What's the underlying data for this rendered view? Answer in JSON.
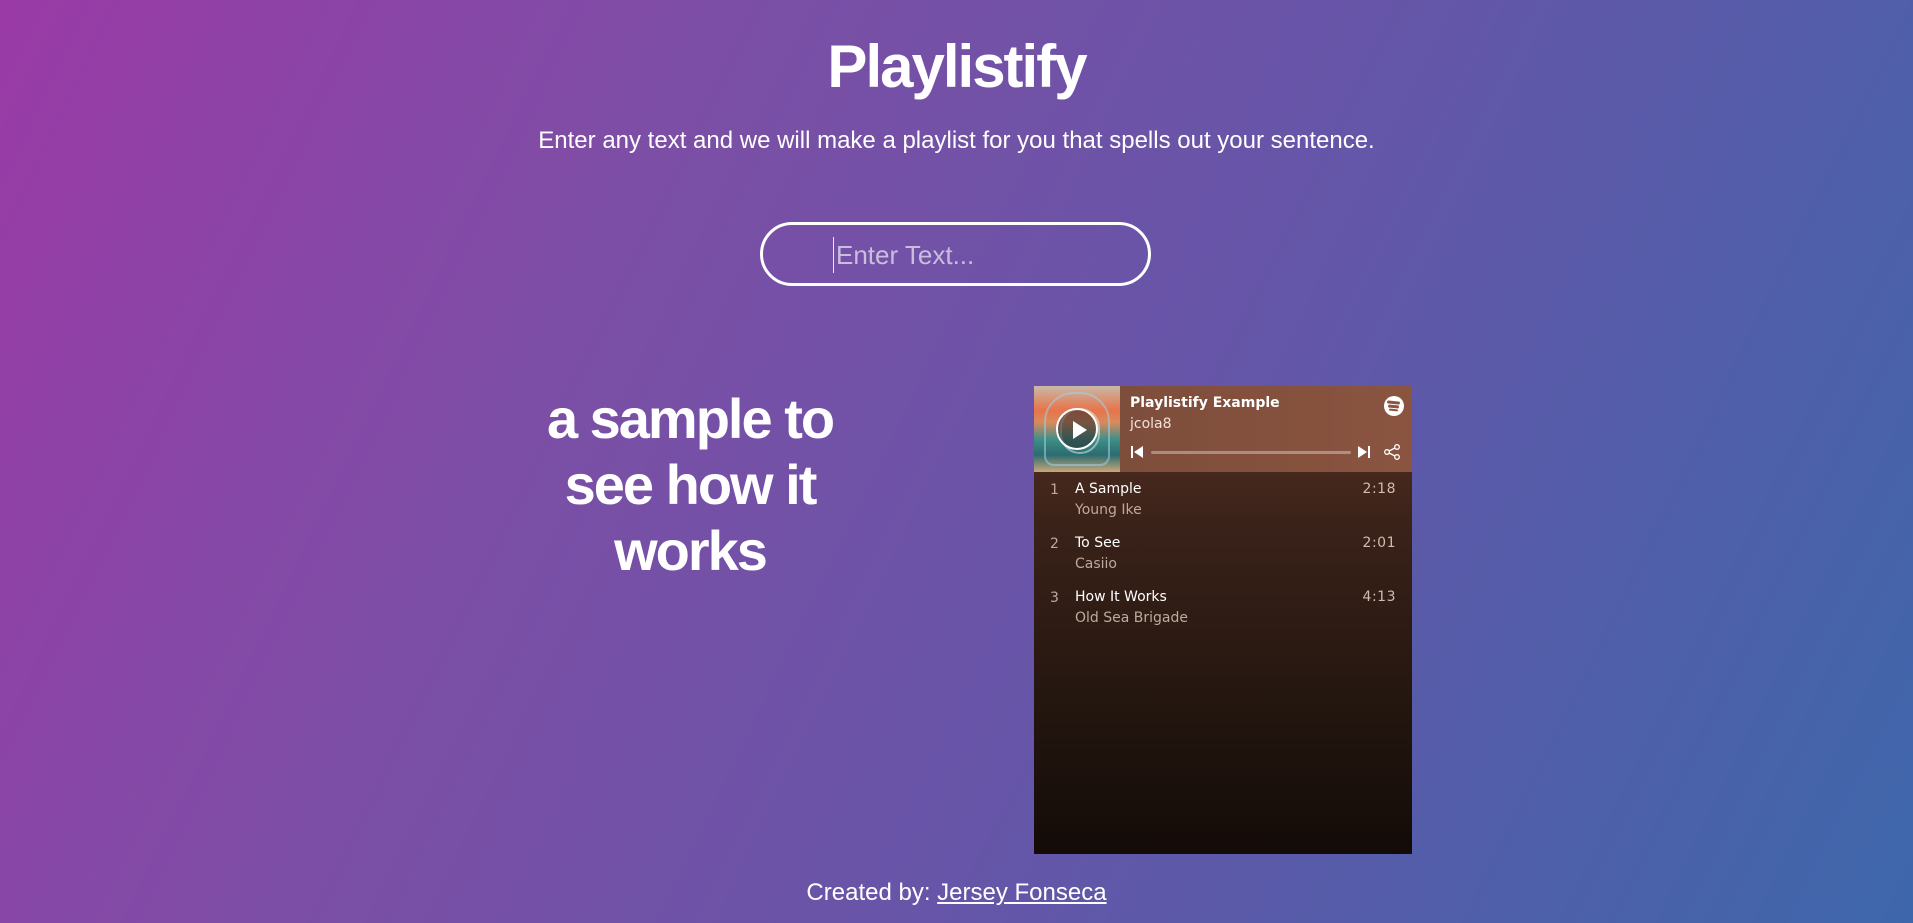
{
  "header": {
    "title": "Playlistify",
    "subtitle": "Enter any text and we will make a playlist for you that spells out your sentence."
  },
  "search": {
    "placeholder": "Enter Text...",
    "value": ""
  },
  "sentence": "a sample to see how it works",
  "player": {
    "playlist_title": "Playlistify Example",
    "owner": "jcola8",
    "progress": 0,
    "tracks": [
      {
        "number": "1",
        "name": "A Sample",
        "artist": "Young Ike",
        "duration": "2:18"
      },
      {
        "number": "2",
        "name": "To See",
        "artist": "Casiio",
        "duration": "2:01"
      },
      {
        "number": "3",
        "name": "How It Works",
        "artist": "Old Sea Brigade",
        "duration": "4:13"
      }
    ],
    "icons": [
      "play-icon",
      "spotify-icon",
      "previous-track-icon",
      "next-track-icon",
      "share-icon"
    ]
  },
  "footer": {
    "prefix": "Created by: ",
    "author": "Jersey Fonseca"
  },
  "colors": {
    "gradient_start": "#9a3aa6",
    "gradient_end": "#3e67ab",
    "player_header": "#7a4c3a"
  }
}
